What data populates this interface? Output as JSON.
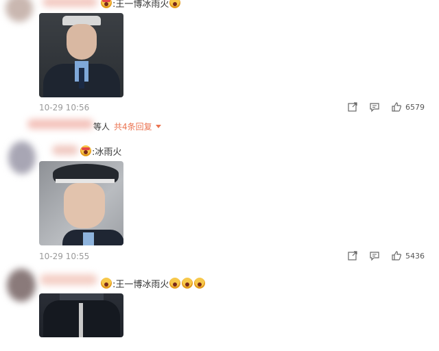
{
  "comments": [
    {
      "text": ":王一博冰雨火",
      "time": "10-29 10:56",
      "likes": "6579"
    },
    {
      "text": ":冰雨火",
      "time": "10-29 10:55",
      "likes": "5436"
    },
    {
      "text": ":王一博冰雨火"
    }
  ],
  "reply_summary": {
    "suffix": "等人",
    "link": "共4条回复"
  },
  "icons": [
    "share-icon",
    "comment-icon",
    "like-icon",
    "dropdown-arrow-icon",
    "emoji-icon"
  ],
  "colors": {
    "link": "#eb7350",
    "time": "#999999",
    "icon": "#666666"
  }
}
